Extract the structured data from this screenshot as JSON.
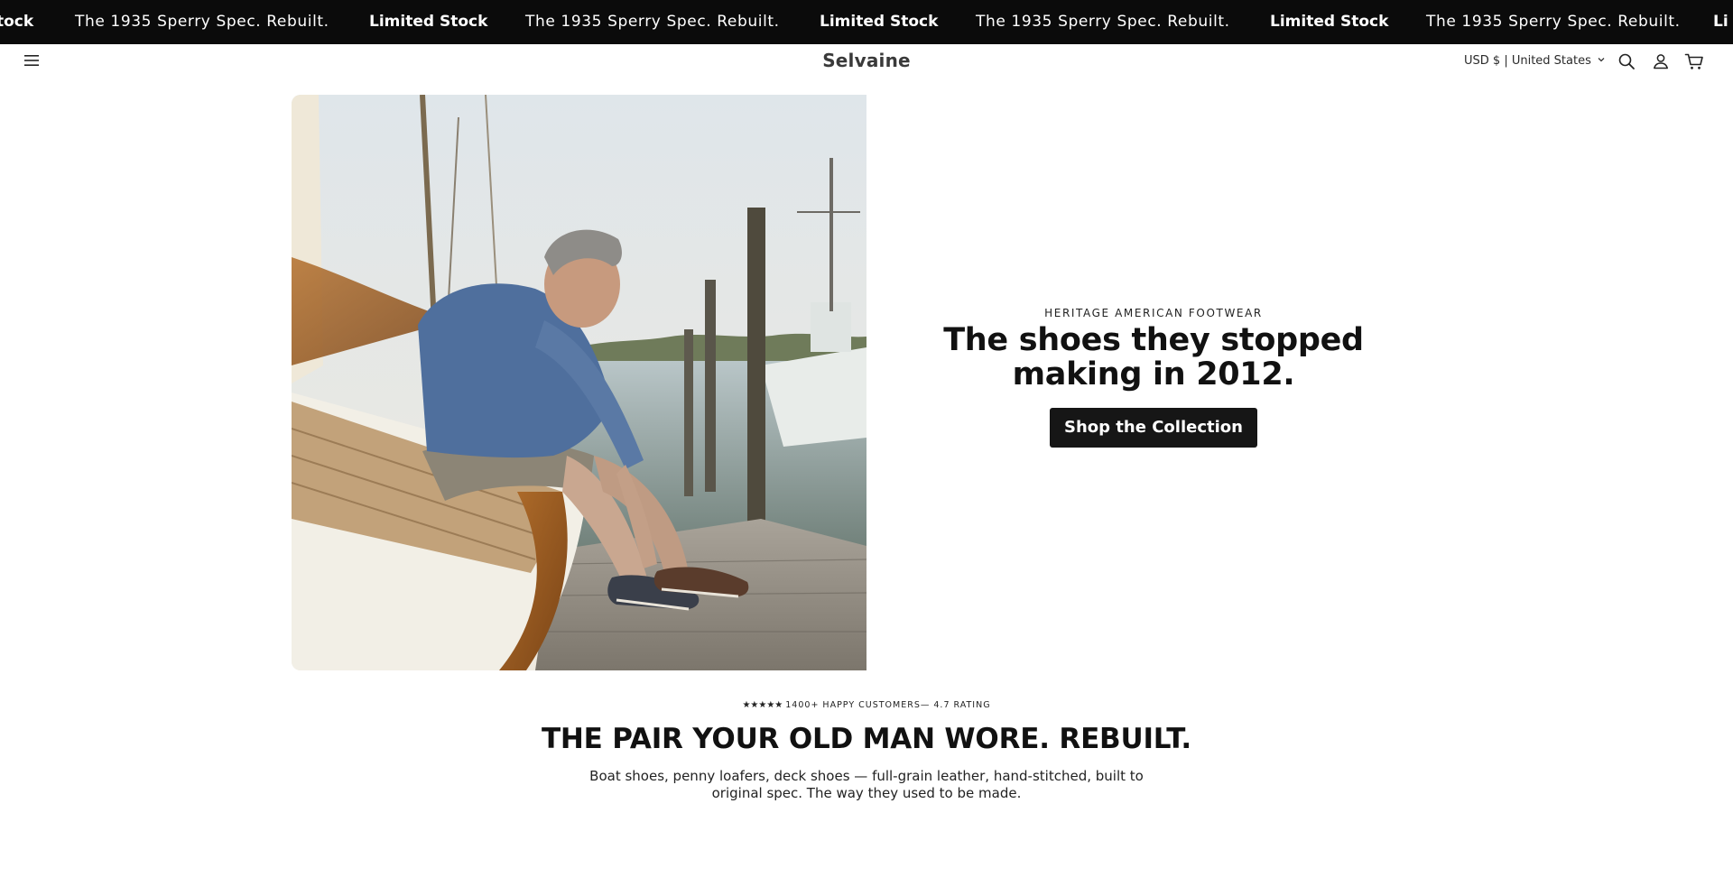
{
  "announcement": {
    "items": [
      {
        "text": "tock",
        "style": "bold"
      },
      {
        "text": "The 1935 Sperry Spec. Rebuilt.",
        "style": "regular"
      },
      {
        "text": "Limited Stock",
        "style": "bold"
      },
      {
        "text": "The 1935 Sperry Spec. Rebuilt.",
        "style": "regular"
      },
      {
        "text": "Limited Stock",
        "style": "bold"
      },
      {
        "text": "The 1935 Sperry Spec. Rebuilt.",
        "style": "regular"
      },
      {
        "text": "Limited Stock",
        "style": "bold"
      },
      {
        "text": "The 1935 Sperry Spec. Rebuilt.",
        "style": "regular"
      },
      {
        "text": "Li",
        "style": "bold"
      }
    ]
  },
  "header": {
    "menu_icon": "hamburger-menu-icon",
    "brand": "Selvaine",
    "locale": "USD $ | United States",
    "icons": [
      "search-icon",
      "account-icon",
      "cart-icon"
    ]
  },
  "hero": {
    "image_subject": "man-tying-boat-shoes-on-dock",
    "eyebrow": "HERITAGE AMERICAN FOOTWEAR",
    "headline_line1": "The shoes they stopped",
    "headline_line2": "making in 2012.",
    "cta": "Shop the Collection"
  },
  "social_proof": {
    "stars": "★★★★★",
    "text": "1400+ HAPPY CUSTOMERS— 4.7 RATING"
  },
  "intro": {
    "title": "THE PAIR YOUR OLD MAN WORE. REBUILT.",
    "body": "Boat shoes, penny loafers, deck shoes — full-grain leather, hand-stitched, built to original spec. The way they used to be made."
  },
  "colors": {
    "bar_bg": "#0b0b0b",
    "cta_bg": "#161616",
    "text": "#121212"
  }
}
